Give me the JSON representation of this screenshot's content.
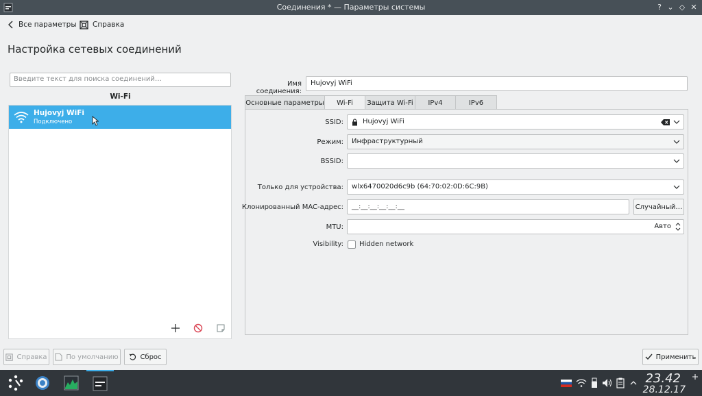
{
  "window": {
    "title": "Соединения * — Параметры системы"
  },
  "toolbar": {
    "back_label": "Все параметры",
    "help_label": "Справка"
  },
  "page": {
    "title": "Настройка сетевых соединений"
  },
  "left": {
    "search_placeholder": "Введите текст для поиска соединений…",
    "group": "Wi-Fi",
    "connections": [
      {
        "name": "Hujovyj WiFi",
        "status": "Подключено"
      }
    ]
  },
  "right": {
    "name_label": "Имя соединения:",
    "name_value": "Hujovyj WiFi",
    "tabs": [
      "Основные параметры",
      "Wi-Fi",
      "Защита Wi-Fi",
      "IPv4",
      "IPv6"
    ],
    "active_tab": "Wi-Fi",
    "ssid_label": "SSID:",
    "ssid_value": "Hujovyj WiFi",
    "mode_label": "Режим:",
    "mode_value": "Инфраструктурный",
    "bssid_label": "BSSID:",
    "bssid_value": "",
    "device_label": "Только для устройства:",
    "device_value": "wlx6470020d6c9b (64:70:02:0D:6C:9B)",
    "mac_label": "Клонированный MAC-адрес:",
    "mac_value": "__:__:__:__:__:__",
    "random_label": "Случайный…",
    "mtu_label": "MTU:",
    "mtu_value": "Авто",
    "visibility_label": "Visibility:",
    "hidden_label": "Hidden network"
  },
  "footer": {
    "help_label": "Справка",
    "defaults_label": "По умолчанию",
    "reset_label": "Сброс",
    "apply_label": "Применить"
  },
  "taskbar": {
    "time": "23.42",
    "date": "28.12.17"
  },
  "colors": {
    "accent": "#3daee9",
    "titlebar": "#475057",
    "panel": "#31363b"
  }
}
